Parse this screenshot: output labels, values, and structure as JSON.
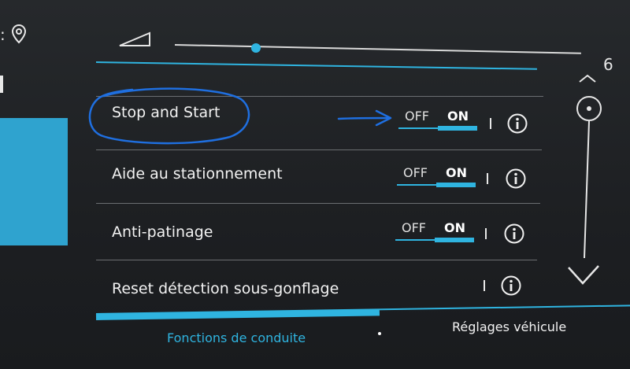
{
  "colors": {
    "accent": "#2fb4e0",
    "annotation": "#1f6fe0",
    "background": "#1e2023",
    "text": "#f2f2f2"
  },
  "volume": {
    "value": "6",
    "level_fraction": 0.2,
    "icon": "volume-triangle-icon"
  },
  "rows": [
    {
      "label": "Stop and Start",
      "off": "OFF",
      "on": "ON"
    },
    {
      "label": "Aide au stationnement",
      "off": "OFF",
      "on": "ON"
    },
    {
      "label": "Anti-patinage",
      "off": "OFF",
      "on": "ON"
    },
    {
      "label": "Reset détection sous-gonflage"
    }
  ],
  "tabs": {
    "active": "Fonctions de conduite",
    "inactive": "Réglages véhicule"
  }
}
